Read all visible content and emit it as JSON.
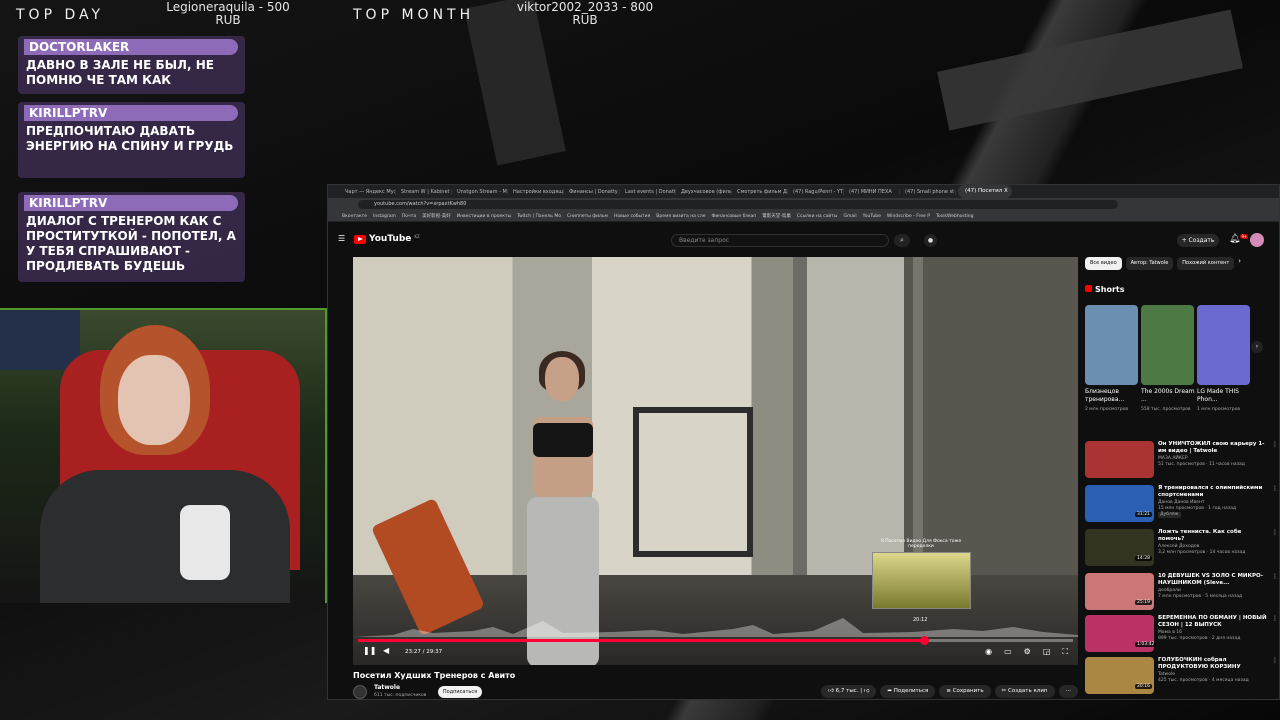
{
  "top": {
    "day_label": "TOP DAY",
    "day_donor": "Legioneraquila - 500",
    "day_currency": "RUB",
    "month_label": "TOP MONTH",
    "month_donor": "viktor2002_2033 - 800",
    "month_currency": "RUB"
  },
  "chat": [
    {
      "user": "DOCTORLAKER",
      "text": "ДАВНО В ЗАЛЕ НЕ БЫЛ, НЕ ПОМНЮ ЧЕ ТАМ КАК"
    },
    {
      "user": "KIRILLPTRV",
      "text": "ПРЕДПОЧИТАЮ ДАВАТЬ ЭНЕРГИЮ НА СПИНУ И ГРУДЬ"
    },
    {
      "user": "KIRILLPTRV",
      "text": "ДИАЛОГ С ТРЕНЕРОМ КАК С ПРОСТИТУТКОЙ - ПОПОТЕЛ, А У ТЕБЯ СПРАШИВАЮТ - ПРОДЛЕВАТЬ БУДЕШЬ"
    }
  ],
  "browser": {
    "tabs": [
      "Чарт — Яндекс Музы",
      "Stream W | Kabinet",
      "Unstgon Stream - Mu",
      "Настройки входящ",
      "Финансы | Donatty",
      "Last events | Donatti",
      "Двухчасовое (фильм",
      "Смотреть фильм Дн",
      "(47) Ragu/Penri - YT",
      "(47) МИНИ ПЕХА",
      "(47) Small phone st",
      "(47) Посетил Х"
    ],
    "url": "youtube.com/watch?v=xrpaxtKwh80",
    "bookmarks": [
      "Вконтакте",
      "Instagram",
      "Почта",
      "美好影视-美好",
      "Инвестиции в проекты",
      "Twitch | Панель Мо",
      "Сниппеты фильм",
      "Новые события",
      "Время визита на сле",
      "Финансовые бэкап",
      "電影天堂-鳥巢",
      "Ссылки на сайты",
      "Gmail",
      "YouTube",
      "Windscribe - Free P",
      "ToolsWebhosting"
    ]
  },
  "youtube": {
    "logo": "YouTube",
    "logo_region": "KZ",
    "search_placeholder": "Введите запрос",
    "create_label": "Создать",
    "bell_badge": "9+",
    "video_title": "Посетил Худших Тренеров с Авито",
    "channel": "Tatwole",
    "subscribers": "611 тыс. подписчиков",
    "subscribe_label": "Подписаться",
    "likes": "6,7 тыс.",
    "share_label": "Поделиться",
    "save_label": "Сохранить",
    "clip_label": "Создать клип",
    "time_current": "23:27",
    "time_total": "29:37",
    "progress_fraction": 0.792,
    "miniplayer_caption": "Я Посетил Видео Для Фокса тоже переделки",
    "miniplayer_time": "20:12",
    "chips": [
      "Все видео",
      "Автор: Tatwole",
      "Похожий контент"
    ],
    "shorts_label": "Shorts",
    "shorts": [
      {
        "title": "Близнецов тренирова...",
        "views": "2 млн просмотров",
        "color": "#6b8fb0"
      },
      {
        "title": "The 2000s Dream ...",
        "views": "558 тыс. просмотров",
        "color": "#4d7a44"
      },
      {
        "title": "LG Made THIS Phon...",
        "views": "1 млн просмотров",
        "color": "#6a6ad0"
      }
    ],
    "recs": [
      {
        "title": "Он УНИЧТОЖИЛ свою карьеру 1-им видео | Tatwole",
        "channel": "МАЗА.АЙКЕР",
        "meta": "51 тыс. просмотров · 11 часов назад",
        "dur": "",
        "color": "#a33"
      },
      {
        "title": "Я тренировался с олимпийскими спортсменами",
        "channel": "Данов Данов Ивент",
        "meta": "15 млн просмотров · 1 год назад",
        "dur": "31:21",
        "extra": "Дубляж",
        "color": "#2a5fb3"
      },
      {
        "title": "Ложть тенниста. Как собе помочь?",
        "channel": "Алексей Доходов",
        "meta": "3,2 млн просмотров · 14 часов назад",
        "dur": "14:28",
        "color": "#332"
      },
      {
        "title": "10 ДЕВУШЕК VS ЗОЛО С МИКРО-НАУШНИКОМ (Sleve...",
        "channel": "деобрали",
        "meta": "7 млн просмотров · 5 месяца назад",
        "dur": "25:19",
        "color": "#c77"
      },
      {
        "title": "БЕРЕМЕННА ПО ОБМАНУ | НОВЫЙ СЕЗОН | 12 ВЫПУСК",
        "channel": "Мама в 16",
        "meta": "899 тыс. просмотров · 2 дня назад",
        "dur": "1:03:42",
        "color": "#b36"
      },
      {
        "title": "ГОЛУБОЧКИН собрал ПРОДУКТОВУЮ КОРЗИНУ",
        "channel": "Tatwole",
        "meta": "425 тыс. просмотров · 4 месяца назад",
        "dur": "20:16",
        "color": "#a84"
      }
    ]
  }
}
